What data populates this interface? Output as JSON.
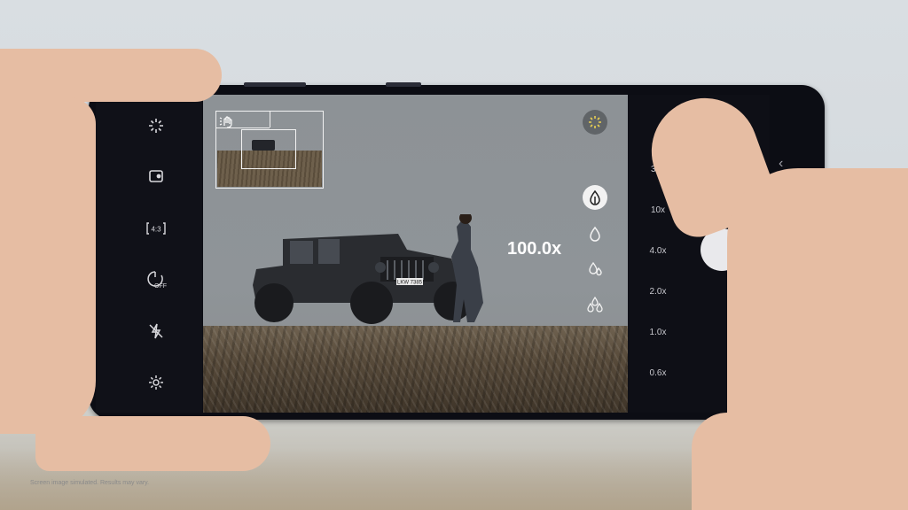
{
  "camera": {
    "zoom_indicator": "100.0x",
    "zoom_steps": [
      "30x",
      "10x",
      "4.0x",
      "2.0x",
      "1.0x",
      "0.6x"
    ],
    "left_controls": [
      "sparkle-icon",
      "motion-photo-icon",
      "aspect-ratio-icon",
      "timer-off-icon",
      "flash-off-icon",
      "settings-icon"
    ],
    "aspect_ratio_label": "4:3",
    "timer_label": "OFF",
    "side_controls": [
      "ai-scene-icon",
      "zoom-lock-icon",
      "drop-icon",
      "double-drop-icon",
      "triple-drop-icon"
    ]
  },
  "overlay": {
    "plate_text": "LKW 7385"
  },
  "caption": "Screen image simulated. Results may vary.",
  "colors": {
    "accent_yellow": "#e8cf52",
    "ui_white": "#ffffff"
  }
}
